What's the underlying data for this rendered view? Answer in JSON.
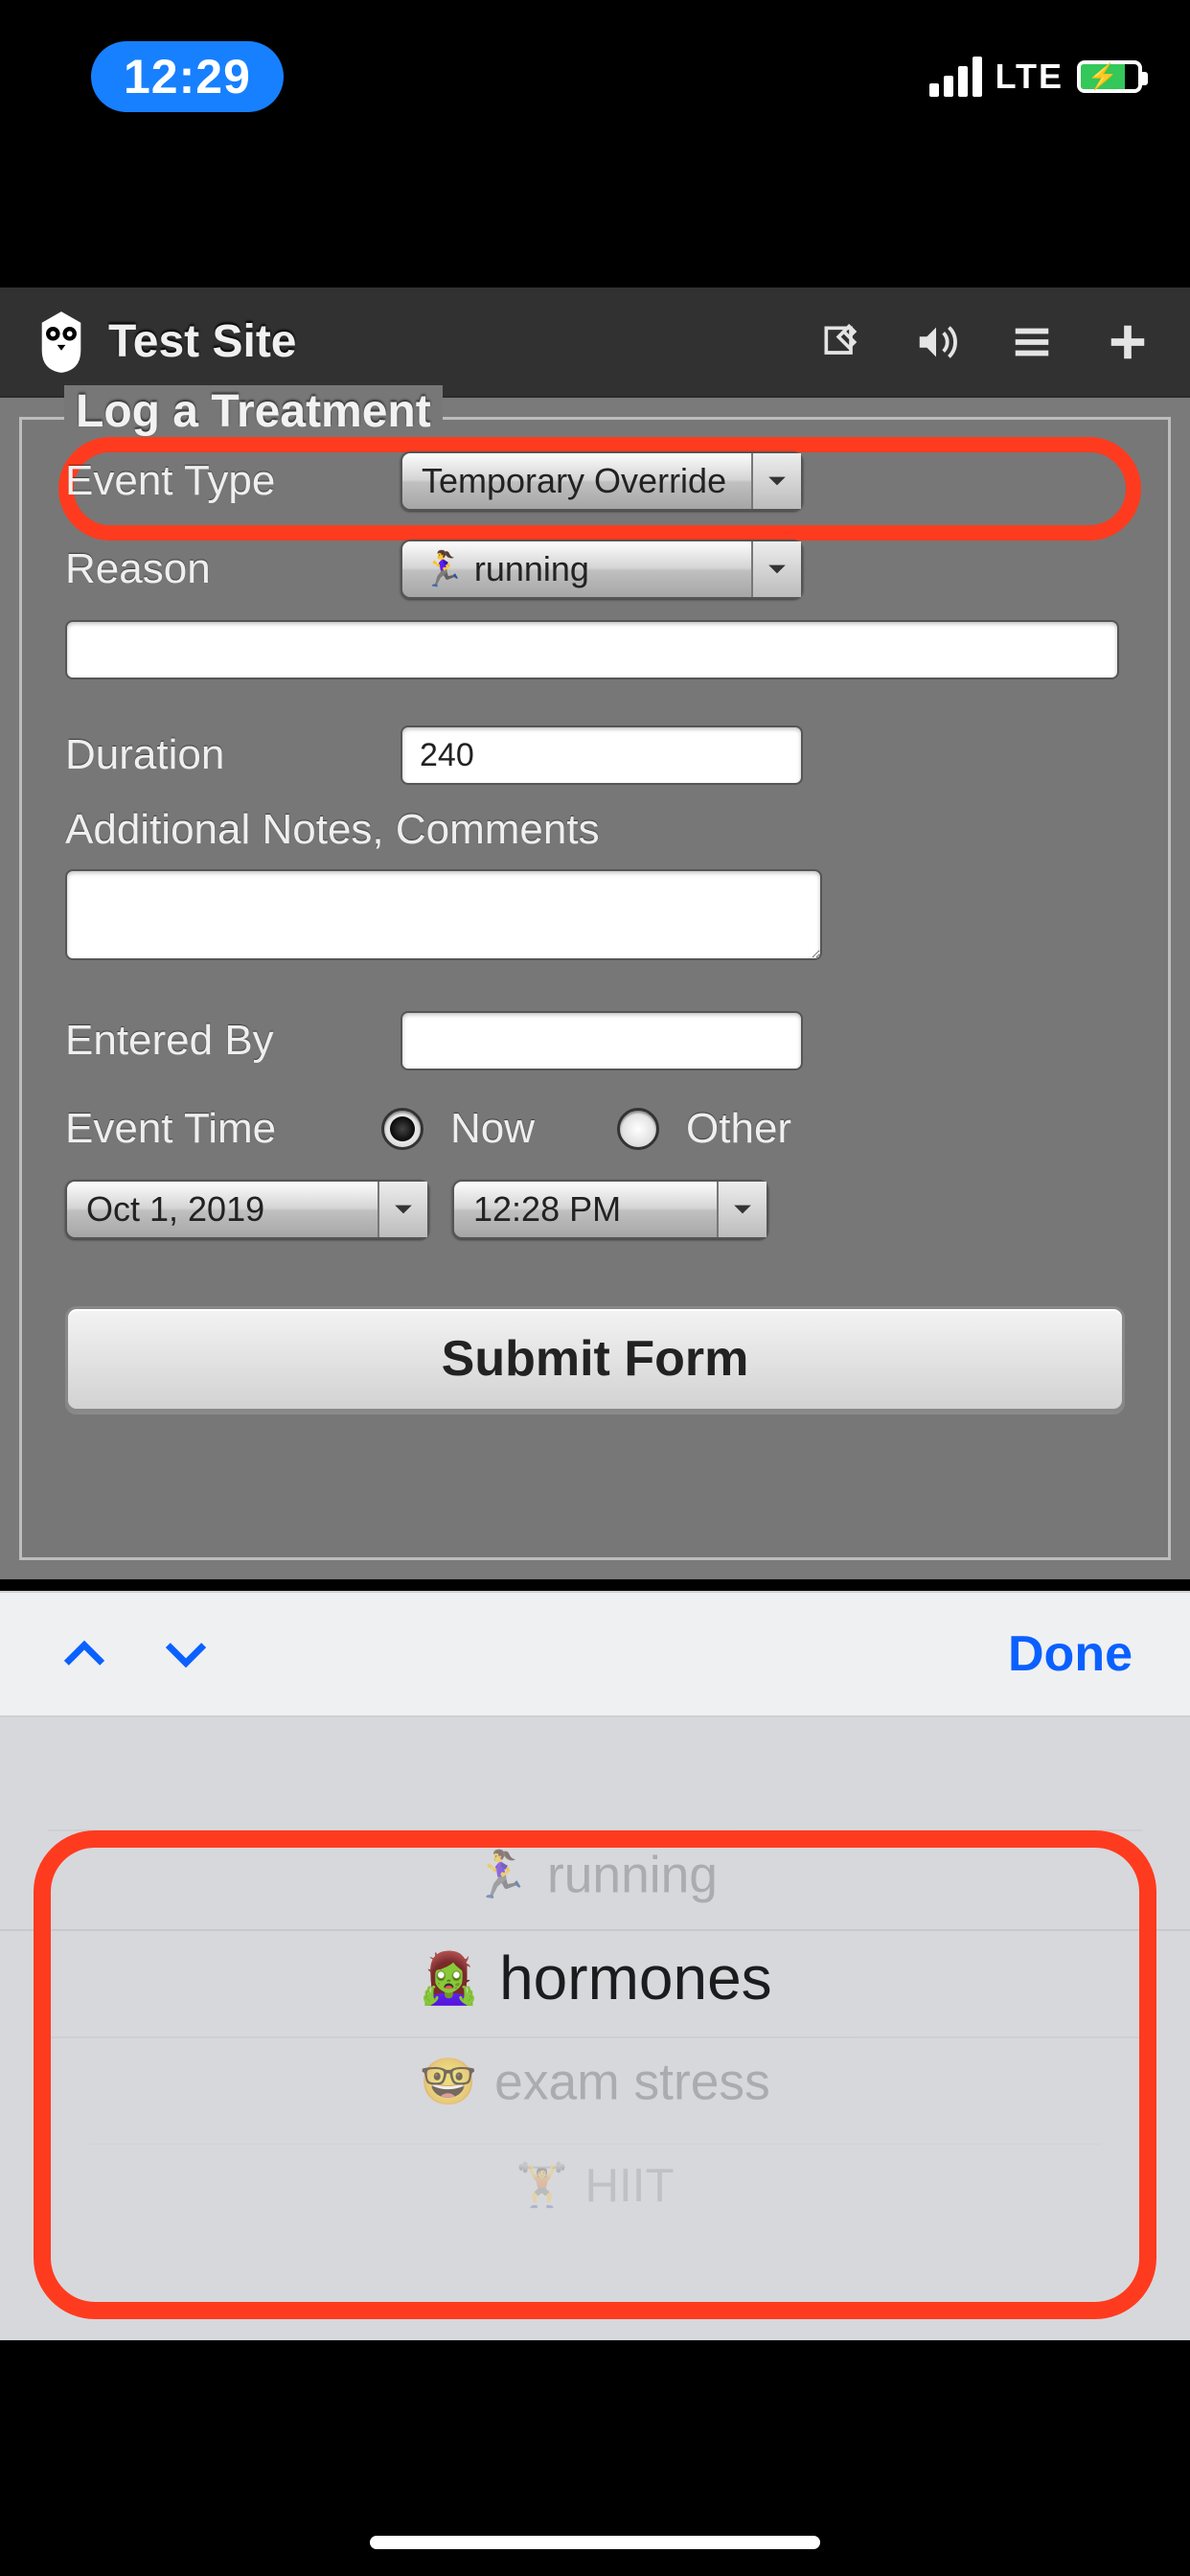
{
  "statusbar": {
    "time": "12:29",
    "network": "LTE"
  },
  "header": {
    "title": "Test Site",
    "icons": {
      "edit": "edit-icon",
      "sound": "volume-icon",
      "menu": "menu-icon",
      "add": "plus-icon"
    }
  },
  "form": {
    "legend": "Log a Treatment",
    "event_type": {
      "label": "Event Type",
      "value": "Temporary Override"
    },
    "reason": {
      "label": "Reason",
      "value": "🏃‍♀️ running"
    },
    "reason_text": {
      "value": ""
    },
    "duration": {
      "label": "Duration",
      "value": "240"
    },
    "notes": {
      "label": "Additional Notes, Comments",
      "value": ""
    },
    "entered_by": {
      "label": "Entered By",
      "value": ""
    },
    "event_time": {
      "label": "Event Time",
      "now_label": "Now",
      "other_label": "Other",
      "selected": "now",
      "date": "Oct 1, 2019",
      "time": "12:28 PM"
    },
    "submit": "Submit Form"
  },
  "assistbar": {
    "done": "Done"
  },
  "picker": {
    "options": [
      {
        "emoji": "🏃‍♀️",
        "label": "running"
      },
      {
        "emoji": "🧟‍♀️",
        "label": "hormones"
      },
      {
        "emoji": "🤓",
        "label": "exam stress"
      },
      {
        "emoji": "🏋️",
        "label": "HIIT"
      }
    ],
    "selected_index": 1
  }
}
